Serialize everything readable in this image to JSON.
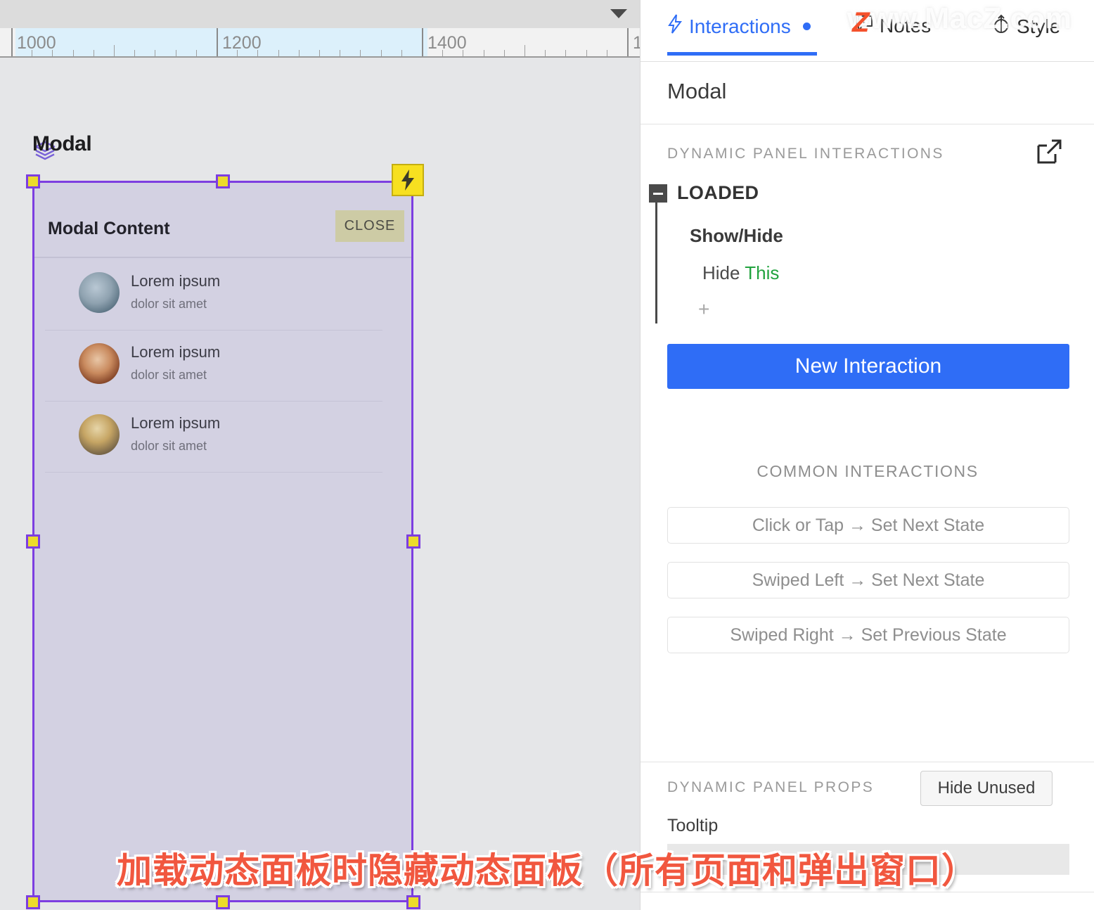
{
  "canvas": {
    "ruler": {
      "labels": [
        "1000",
        "1200",
        "1400",
        "1"
      ],
      "dropdown_icon": "caret-down-icon"
    },
    "widget_label": "Modal",
    "widget_icon": "layers-icon",
    "selection": {
      "badge_icon": "lightning-bolt-icon"
    },
    "modal": {
      "title": "Modal Content",
      "close_label": "CLOSE",
      "rows": [
        {
          "title": "Lorem ipsum",
          "subtitle": "dolor sit amet",
          "avatar": "avatar-grey-blue"
        },
        {
          "title": "Lorem ipsum",
          "subtitle": "dolor sit amet",
          "avatar": "avatar-auburn"
        },
        {
          "title": "Lorem ipsum",
          "subtitle": "dolor sit amet",
          "avatar": "avatar-blonde"
        }
      ]
    }
  },
  "panel": {
    "tabs": [
      {
        "label": "Interactions",
        "icon": "lightning-bolt-icon",
        "active": true,
        "has_dot": true
      },
      {
        "label": "Notes",
        "icon": "note-comment-icon",
        "active": false,
        "has_dot": false
      },
      {
        "label": "Style",
        "icon": "paint-style-icon",
        "active": false,
        "has_dot": false
      }
    ],
    "title": "Modal",
    "dynamic_panel_interactions": {
      "heading": "DYNAMIC PANEL INTERACTIONS",
      "popout_icon": "external-link-icon",
      "event": {
        "collapse_icon": "minus-box-icon",
        "name": "LOADED",
        "action_group": "Show/Hide",
        "action_verb": "Hide",
        "action_target": "This",
        "add_label": "+"
      }
    },
    "new_interaction_label": "New Interaction",
    "common_interactions": {
      "heading": "COMMON INTERACTIONS",
      "items": [
        "Click or Tap → Set Next State",
        "Swiped Left → Set Next State",
        "Swiped Right → Set Previous State"
      ]
    },
    "dynamic_panel_props": {
      "heading": "DYNAMIC PANEL PROPS",
      "hide_unused_label": "Hide Unused",
      "tooltip_label": "Tooltip",
      "tooltip_value": "",
      "tooltip_placeholder": ""
    }
  },
  "watermark": {
    "text": "www.MacZ.com",
    "logo": "Z"
  },
  "caption": {
    "text": "加载动态面板时隐藏动态面板（所有页面和弹出窗口）"
  },
  "colors": {
    "accent_blue": "#2f6df6",
    "selection_purple": "#7d3ee0",
    "handle_yellow": "#ecdc2a",
    "target_green": "#22a33f",
    "canvas_bg": "#e5e6e8",
    "panel_bg": "#d3d1e2",
    "close_btn": "#cdcba5",
    "caption_red": "#f1573f"
  }
}
